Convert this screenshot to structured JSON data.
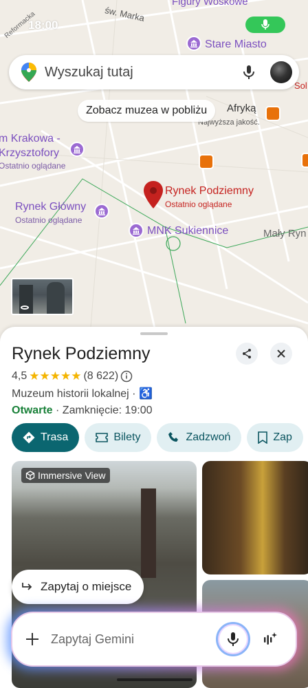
{
  "status_bar": {
    "time": "18:00"
  },
  "map": {
    "streets": [
      "Reformacka",
      "św. Marka"
    ],
    "labels": {
      "figury": "Figury Woskowe",
      "stare_miasto": "Stare Miasto",
      "afryka": "Afryką",
      "najwyzsza": "Najwyższa jakość.",
      "sol": "Sol",
      "krakowa": "m Krakowa -",
      "krzysztofory": "Krzysztofory",
      "krzysztofory_sub": "Ostatnio oglądane",
      "rynek_glowny": "Rynek Główny",
      "rynek_glowny_sub": "Ostatnio oglądane",
      "rynek_podziemny": "Rynek Podziemny",
      "rynek_podziemny_sub": "Ostatnio oglądane",
      "mnk": "MNK Sukiennice",
      "maly_rynek": "Mały Ryn"
    },
    "colors": {
      "poi_purple": "#9b6ad2",
      "selected_red": "#c5221f",
      "food_orange": "#e8710a"
    }
  },
  "search": {
    "placeholder": "Wyszukaj tutaj"
  },
  "chip_nearby": "Zobacz muzea w pobliżu",
  "place": {
    "title": "Rynek Podziemny",
    "rating": "4,5",
    "stars": "★★★★★",
    "reviews": "(8 622)",
    "category": "Muzeum historii lokalnej · ♿",
    "open_status": "Otwarte",
    "closing": " · Zamknięcie: 19:00",
    "actions": [
      {
        "label": "Trasa",
        "icon": "directions-icon"
      },
      {
        "label": "Bilety",
        "icon": "ticket-icon"
      },
      {
        "label": "Zadzwoń",
        "icon": "phone-icon"
      },
      {
        "label": "Zap",
        "icon": "bookmark-icon"
      }
    ],
    "immersive_label": "Immersive View"
  },
  "ask_chip": "Zapytaj o miejsce",
  "gemini": {
    "placeholder": "Zapytaj Gemini"
  }
}
